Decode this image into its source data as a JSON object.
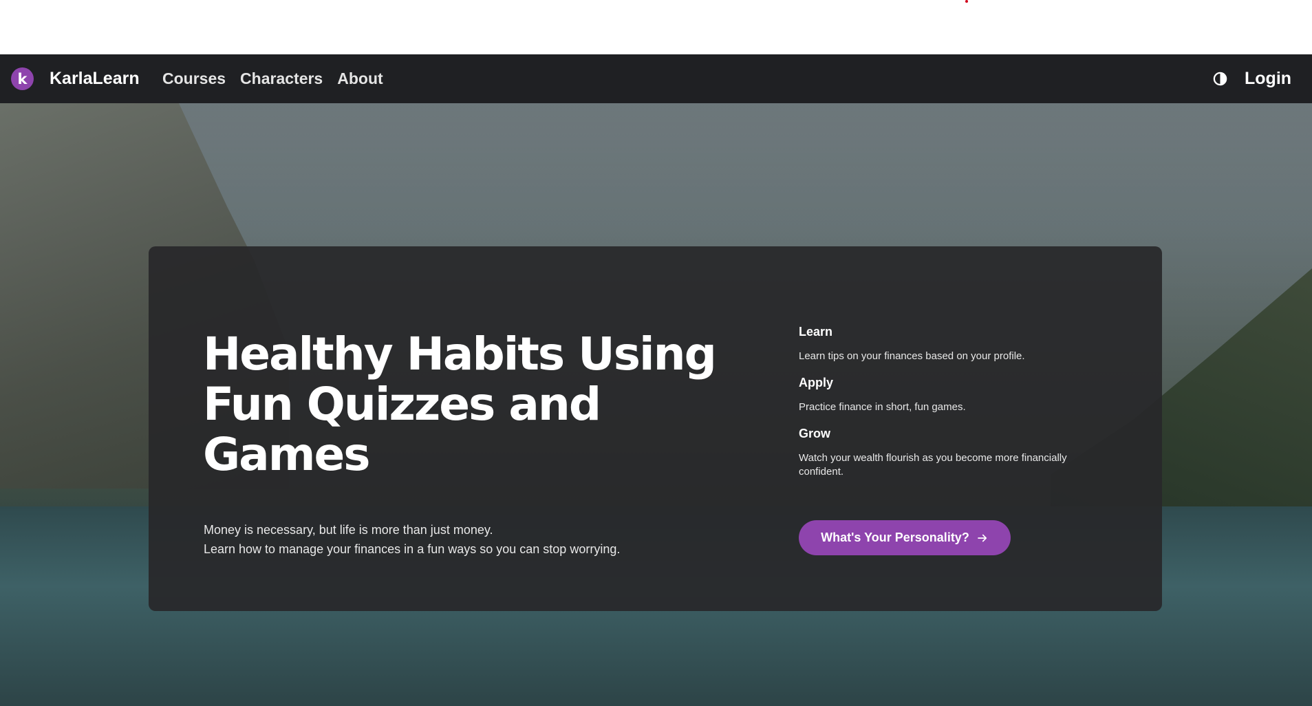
{
  "colors": {
    "accent": "#8e44ad",
    "navbar_bg": "#1f2023",
    "marker": "#d0021b"
  },
  "nav": {
    "logo_letter": "k",
    "brand": "KarlaLearn",
    "links": [
      "Courses",
      "Characters",
      "About"
    ],
    "theme_icon": "contrast-icon",
    "login": "Login"
  },
  "hero": {
    "headline": "Healthy Habits Using Fun Quizzes and Games",
    "subtext_line1": "Money is necessary, but life is more than just money.",
    "subtext_line2": "Learn how to manage your finances in a fun ways so you can stop worrying.",
    "features": [
      {
        "title": "Learn",
        "desc": "Learn tips on your finances based on your profile."
      },
      {
        "title": "Apply",
        "desc": "Practice finance in short, fun games."
      },
      {
        "title": "Grow",
        "desc": "Watch your wealth flourish as you become more financially confident."
      }
    ],
    "cta_label": "What's Your Personality?",
    "cta_icon": "arrow-right-icon"
  }
}
